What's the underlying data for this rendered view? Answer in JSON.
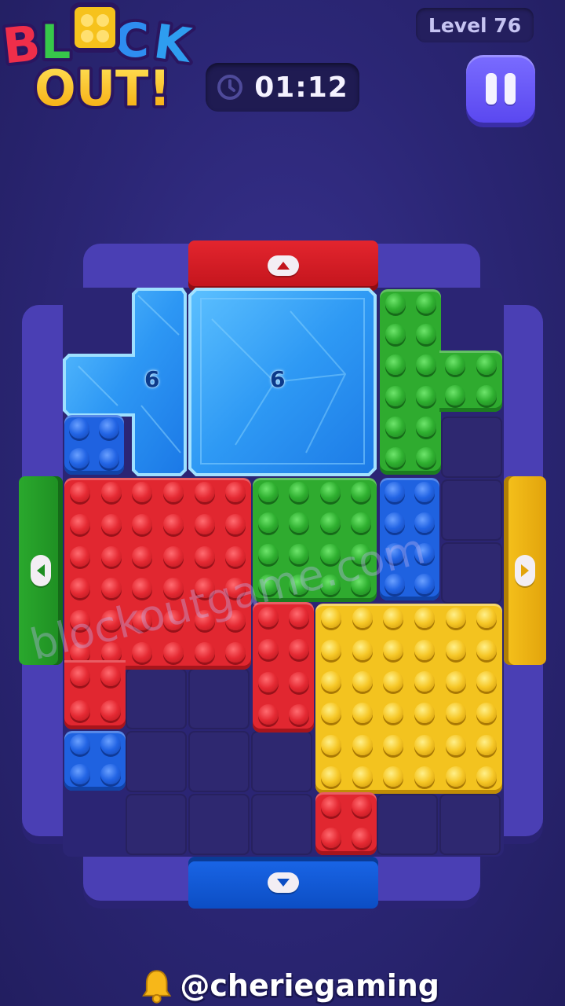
{
  "logo": {
    "text_line1": "BLOCK",
    "text_line2": "OUT!"
  },
  "hud": {
    "timer": "01:12",
    "level": "Level 76"
  },
  "board": {
    "ice_blocks": [
      {
        "id": "ice-cross",
        "count": "6"
      },
      {
        "id": "ice-square",
        "count": "6"
      }
    ],
    "exits": [
      {
        "side": "top",
        "color": "#e3252e",
        "arrow": "up"
      },
      {
        "side": "bottom",
        "color": "#1a66e8",
        "arrow": "down"
      },
      {
        "side": "left",
        "color": "#2aa82d",
        "arrow": "left"
      },
      {
        "side": "right",
        "color": "#f6c21c",
        "arrow": "right"
      }
    ],
    "colors": {
      "red": "#e12730",
      "green": "#2fab2f",
      "blue": "#1f62e0",
      "yellow": "#f3c31f",
      "frame": "#4a3fb4"
    }
  },
  "watermark": "blockoutgame.com",
  "credit": {
    "icon": "bell-icon",
    "handle": "@cheriegaming"
  }
}
